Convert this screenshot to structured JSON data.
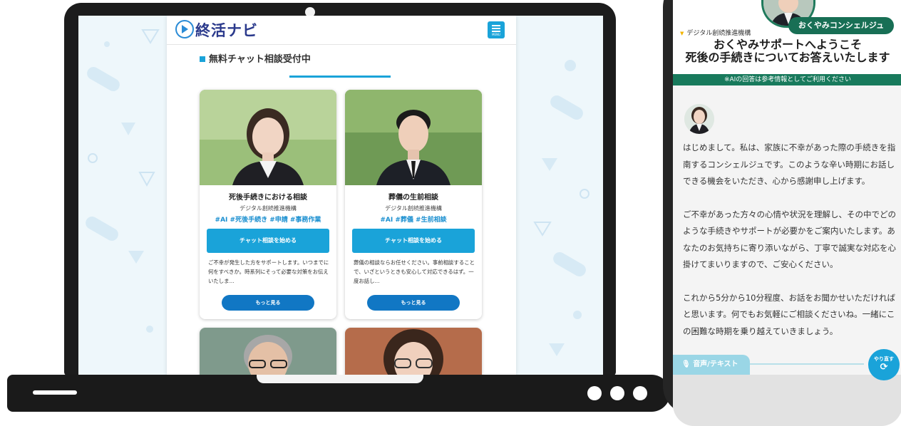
{
  "site": {
    "logo_text": "終活ナビ",
    "menu_label": "MENU",
    "section_title": "無料チャット相談受付中",
    "cards": [
      {
        "title": "死後手続きにおける相談",
        "org": "デジタル創続推進機構",
        "tags": "#AI #死後手続き #申請 #事務作業",
        "start_button": "チャット相談を始める",
        "description": "ご不幸が発生した方をサポートします。いつまでに何をすべきか。時系列にそって必要な対策をお伝えいたしま...",
        "more_button": "もっと見る"
      },
      {
        "title": "葬儀の生前相談",
        "org": "デジタル創続推進機構",
        "tags": "#AI #葬儀 #生前相談",
        "start_button": "チャット相談を始める",
        "description": "葬儀の相談ならお任せください。事前相談することで、いざというときも安心して対応できるはず。一度お話し...",
        "more_button": "もっと見る"
      }
    ]
  },
  "phone": {
    "badge": "おくやみコンシェルジュ",
    "org": "デジタル創続推進機構",
    "welcome_line1": "おくやみサポートへようこそ",
    "welcome_line2": "死後の手続きについてお答えいたします",
    "notice": "※AIの回答は参考情報としてご利用ください",
    "messages": [
      "はじめまして。私は、家族に不幸があった際の手続きを指南するコンシェルジュです。このような辛い時期にお話しできる機会をいただき、心から感謝申し上げます。",
      "ご不幸があった方々の心情や状況を理解し、その中でどのような手続きやサポートが必要かをご案内いたします。あなたのお気持ちに寄り添いながら、丁寧で誠実な対応を心掛けてまいりますので、ご安心ください。",
      "これから5分から10分程度、お話をお聞かせいただければと思います。何でもお気軽にご相談くださいね。一緒にこの困難な時期を乗り越えていきましょう。"
    ],
    "voice_button": "音声/テキスト",
    "redo_button": "やり直す"
  },
  "colors": {
    "accent": "#1aa3d9",
    "phone_green": "#187a5c",
    "logo_navy": "#2b3a8c"
  }
}
